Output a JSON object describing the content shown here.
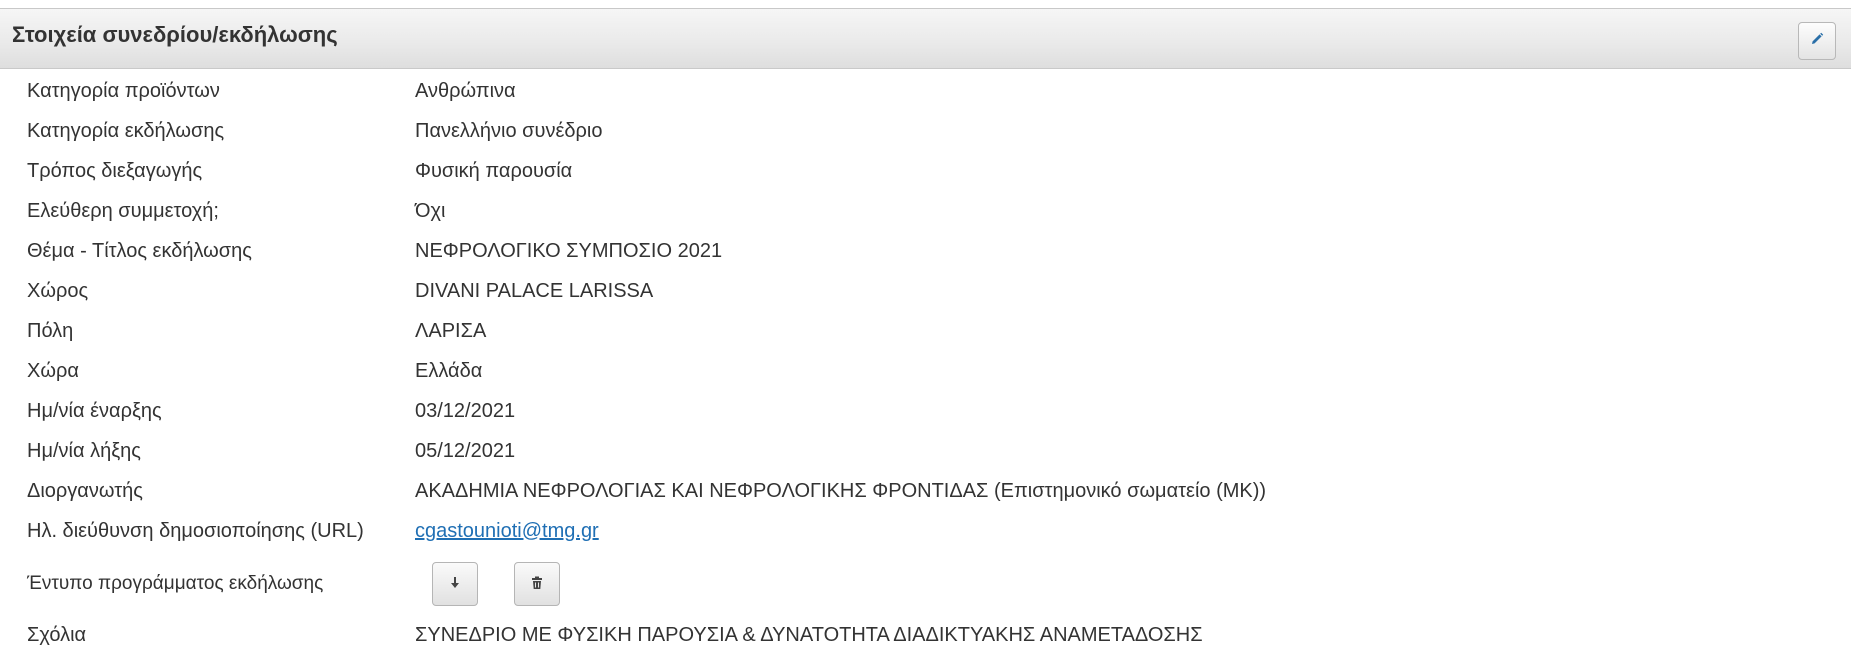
{
  "panel": {
    "title": "Στοιχεία συνεδρίου/εκδήλωσης",
    "edit_icon": "pencil-icon"
  },
  "fields": [
    {
      "label": "Κατηγορία προϊόντων",
      "value": "Ανθρώπινα"
    },
    {
      "label": "Κατηγορία εκδήλωσης",
      "value": "Πανελλήνιο συνέδριο"
    },
    {
      "label": "Τρόπος διεξαγωγής",
      "value": "Φυσική παρουσία"
    },
    {
      "label": "Ελεύθερη συμμετοχή;",
      "value": "Όχι"
    },
    {
      "label": "Θέμα - Τίτλος εκδήλωσης",
      "value": "ΝΕΦΡΟΛΟΓΙΚΟ ΣΥΜΠΟΣΙΟ 2021"
    },
    {
      "label": "Χώρος",
      "value": "DIVANI PALACE LARISSA"
    },
    {
      "label": "Πόλη",
      "value": "ΛΑΡΙΣΑ"
    },
    {
      "label": "Χώρα",
      "value": "Ελλάδα"
    },
    {
      "label": "Ημ/νία έναρξης",
      "value": "03/12/2021"
    },
    {
      "label": "Ημ/νία λήξης",
      "value": "05/12/2021"
    },
    {
      "label": "Διοργανωτής",
      "value": "ΑΚΑΔΗΜΙΑ ΝΕΦΡΟΛΟΓΙΑΣ ΚΑΙ ΝΕΦΡΟΛΟΓΙΚΗΣ ΦΡΟΝΤΙΔΑΣ (Επιστημονικό σωματείο (ΜΚ))"
    },
    {
      "label": "Ηλ. διεύθυνση δημοσιοποίησης (URL)",
      "value": "cgastounioti@tmg.gr"
    }
  ],
  "program": {
    "label": "Έντυπο προγράμματος εκδήλωσης",
    "download_icon": "download-icon",
    "delete_icon": "trash-icon"
  },
  "comments": {
    "label": "Σχόλια",
    "value": "ΣΥΝΕΔΡΙΟ ΜΕ ΦΥΣΙΚΗ ΠΑΡΟΥΣΙΑ & ΔΥΝΑΤΟΤΗΤΑ ΔΙΑΔΙΚΤΥΑΚΗΣ ΑΝΑΜΕΤΑΔΟΣΗΣ"
  }
}
